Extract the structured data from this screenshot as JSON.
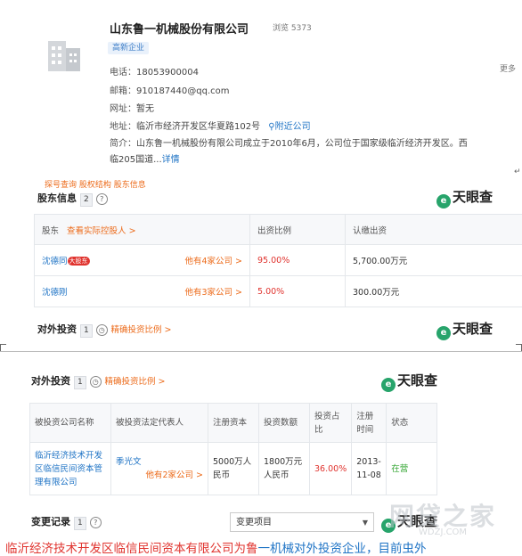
{
  "company": {
    "name": "山东鲁一机械股份有限公司",
    "views": "浏览 5373",
    "tag": "高新企业",
    "phone_label": "电话：",
    "phone": "18053900004",
    "email_label": "邮箱：",
    "email": "910187440@qq.com",
    "website_label": "网址：",
    "website": "暂无",
    "address_label": "地址：",
    "address": "临沂市经济开发区华夏路102号",
    "nearby_link": "附近公司",
    "intro_label": "简介：",
    "intro_line1": "山东鲁一机械股份有限公司成立于2010年6月，公司位于国家级临沂经济开发区。西",
    "intro_line2": "临205国道...",
    "intro_more": "详情",
    "more": "更多"
  },
  "return_mark": "↵",
  "cut_text": "探号查询 股权结构              股东信息",
  "brand": {
    "name": "天眼查",
    "mark": "e"
  },
  "shareholders": {
    "title": "股东信息",
    "count": "2",
    "help": "?",
    "headers": {
      "shareholder": "股东",
      "link": "查看实际控股人 >",
      "ratio": "出资比例",
      "amount": "认缴出资"
    },
    "rows": [
      {
        "name": "沈德同",
        "badge": "大股东",
        "companies": "他有4家公司 >",
        "ratio": "95.00%",
        "amount": "5,700.00万元"
      },
      {
        "name": "沈德刚",
        "badge": "",
        "companies": "他有3家公司 >",
        "ratio": "5.00%",
        "amount": "300.00万元"
      }
    ]
  },
  "investment_cut": {
    "title": "对外投资",
    "count": "1",
    "link": "精确投资比例 >"
  },
  "investment": {
    "title": "对外投资",
    "count": "1",
    "link": "精确投资比例 >",
    "headers": [
      "被投资公司名称",
      "被投资法定代表人",
      "注册资本",
      "投资数额",
      "投资占比",
      "注册时间",
      "状态"
    ],
    "row": {
      "company": "临沂经济技术开发区临信民间资本管理有限公司",
      "rep": "季光文",
      "rep_companies": "他有2家公司 >",
      "capital": "5000万人民币",
      "amount": "1800万元人民币",
      "ratio": "36.00%",
      "date": "2013-11-08",
      "status": "在营"
    }
  },
  "changes": {
    "title": "变更记录",
    "count": "1",
    "select_value": "变更项目",
    "select_arrow": "▼"
  },
  "bottom_text": {
    "part1": "临沂经济技术开发区临信民间资本有限公司为鲁",
    "part2": "一机械对外投资企业，目前虫外"
  },
  "watermark": {
    "text": "网贷之家",
    "url": "WDZJ.COM"
  },
  "colors": {
    "link_blue": "#1e73c5",
    "orange": "#ec6b1b",
    "red": "#e0342f",
    "brand_green": "#27a46b"
  }
}
